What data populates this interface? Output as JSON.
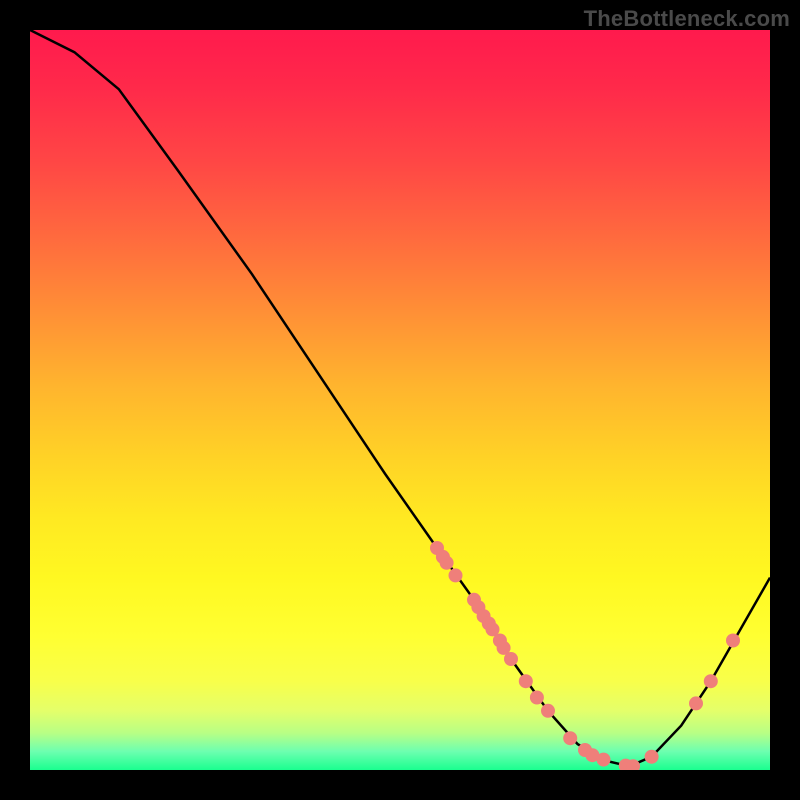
{
  "watermark": "TheBottleneck.com",
  "chart_data": {
    "type": "line",
    "title": "",
    "xlabel": "",
    "ylabel": "",
    "xlim": [
      0,
      100
    ],
    "ylim": [
      0,
      100
    ],
    "grid": false,
    "curve": [
      {
        "x": 0,
        "y": 100
      },
      {
        "x": 6,
        "y": 97
      },
      {
        "x": 12,
        "y": 92
      },
      {
        "x": 20,
        "y": 81
      },
      {
        "x": 30,
        "y": 67
      },
      {
        "x": 40,
        "y": 52
      },
      {
        "x": 48,
        "y": 40
      },
      {
        "x": 55,
        "y": 30
      },
      {
        "x": 60,
        "y": 23
      },
      {
        "x": 65,
        "y": 15
      },
      {
        "x": 70,
        "y": 8
      },
      {
        "x": 74,
        "y": 3.5
      },
      {
        "x": 78,
        "y": 1.2
      },
      {
        "x": 81,
        "y": 0.5
      },
      {
        "x": 84,
        "y": 1.8
      },
      {
        "x": 88,
        "y": 6
      },
      {
        "x": 92,
        "y": 12
      },
      {
        "x": 96,
        "y": 19
      },
      {
        "x": 100,
        "y": 26
      }
    ],
    "markers": [
      {
        "x": 55.0,
        "y": 30.0
      },
      {
        "x": 55.8,
        "y": 28.8
      },
      {
        "x": 56.3,
        "y": 28.0
      },
      {
        "x": 57.5,
        "y": 26.3
      },
      {
        "x": 60.0,
        "y": 23.0
      },
      {
        "x": 60.6,
        "y": 22.0
      },
      {
        "x": 61.3,
        "y": 20.8
      },
      {
        "x": 62.0,
        "y": 19.8
      },
      {
        "x": 62.5,
        "y": 19.0
      },
      {
        "x": 63.5,
        "y": 17.5
      },
      {
        "x": 64.0,
        "y": 16.5
      },
      {
        "x": 65.0,
        "y": 15.0
      },
      {
        "x": 67.0,
        "y": 12.0
      },
      {
        "x": 68.5,
        "y": 9.8
      },
      {
        "x": 70.0,
        "y": 8.0
      },
      {
        "x": 73.0,
        "y": 4.3
      },
      {
        "x": 75.0,
        "y": 2.7
      },
      {
        "x": 76.0,
        "y": 2.0
      },
      {
        "x": 77.5,
        "y": 1.4
      },
      {
        "x": 80.5,
        "y": 0.6
      },
      {
        "x": 81.5,
        "y": 0.5
      },
      {
        "x": 84.0,
        "y": 1.8
      },
      {
        "x": 90.0,
        "y": 9.0
      },
      {
        "x": 92.0,
        "y": 12.0
      },
      {
        "x": 95.0,
        "y": 17.5
      }
    ],
    "marker_color": "#ef7f7a",
    "curve_color": "#000000"
  }
}
